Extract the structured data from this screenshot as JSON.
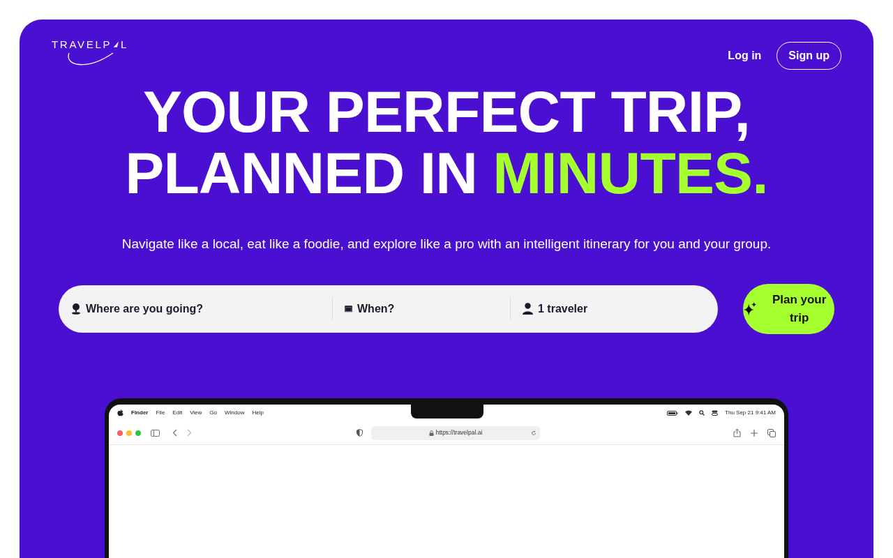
{
  "logo": {
    "text_start": "TRAVELP",
    "text_end": "L"
  },
  "nav": [
    {
      "label": "Log in",
      "kind": "link"
    },
    {
      "label": "Sign up",
      "kind": "outline"
    }
  ],
  "heading": {
    "line_1": "YOUR PERFECT TRIP,",
    "line_2": "PLANNED IN",
    "highlight": "MINUTES."
  },
  "subtitle": "Navigate like a local, eat like a foodie, and explore like a pro with an intelligent itinerary for you and your group.",
  "search": {
    "fields": [
      {
        "kind": "destination",
        "placeholder": "Where are you going?"
      },
      {
        "kind": "date",
        "placeholder": "When?"
      },
      {
        "kind": "travelers",
        "placeholder": "1 traveler"
      }
    ],
    "button": "Plan your trip"
  },
  "laptop": {
    "menu_bar": {
      "menus": [
        "Finder",
        "File",
        "Edit",
        "View",
        "Go",
        "Window",
        "Help"
      ],
      "clock": "Thu Sep 21 9:41 AM"
    },
    "browser": {
      "url": "https://travelpal.ai"
    }
  }
}
